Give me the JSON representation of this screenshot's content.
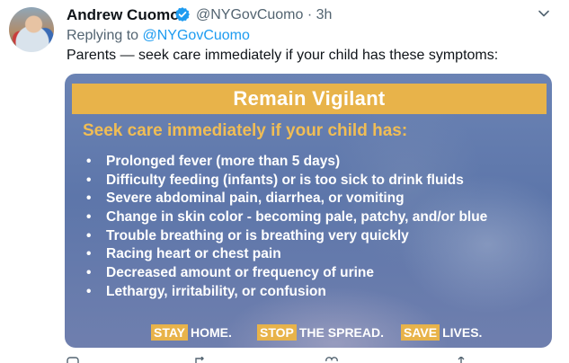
{
  "tweet": {
    "author_name": "Andrew Cuomo",
    "handle_time": "@NYGovCuomo · 3h",
    "replying_prefix": "Replying to",
    "replying_to": "@NYGovCuomo",
    "text": "Parents — seek care immediately if your child has these symptoms:"
  },
  "card": {
    "banner_title": "Remain Vigilant",
    "subhead": "Seek care immediately if your child has:",
    "bullet_char": "•",
    "symptoms": [
      "Prolonged fever (more than 5 days)",
      "Difficulty feeding (infants) or is too sick to drink fluids",
      "Severe abdominal pain, diarrhea, or vomiting",
      "Change in skin color - becoming pale, patchy, and/or blue",
      "Trouble breathing or is breathing very quickly",
      "Racing heart or chest pain",
      "Decreased amount or frequency of urine",
      "Lethargy, irritability, or confusion"
    ],
    "footer": [
      {
        "highlight": "STAY",
        "rest": "HOME."
      },
      {
        "highlight": "STOP",
        "rest": "THE SPREAD."
      },
      {
        "highlight": "SAVE",
        "rest": "LIVES."
      }
    ]
  },
  "icons": {
    "verified": "verified-badge-icon",
    "more": "chevron-down-icon"
  },
  "colors": {
    "brand_blue": "#1d9bf0",
    "banner_gold": "#e8b34a",
    "card_blue": "#6b83b4"
  }
}
